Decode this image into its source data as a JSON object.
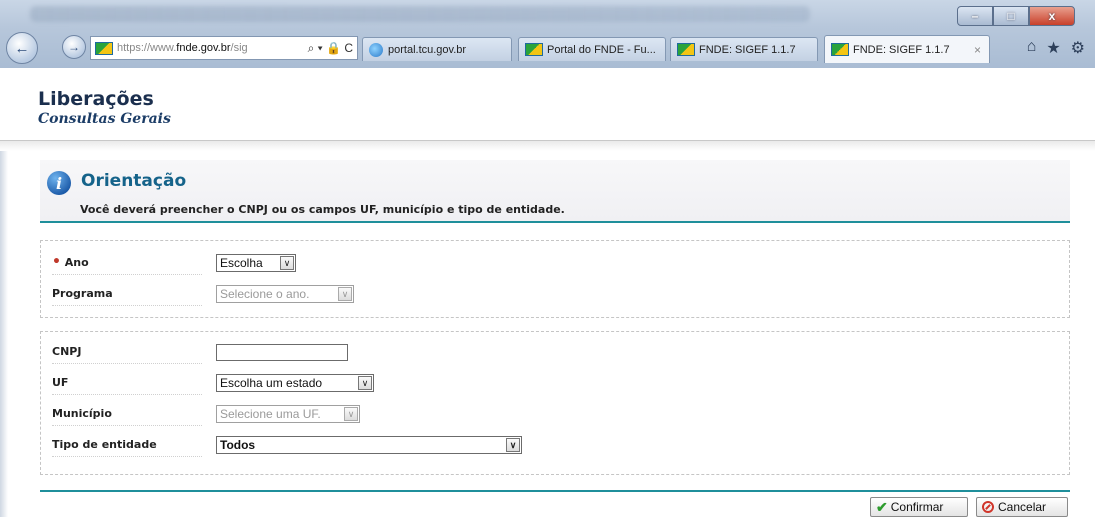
{
  "browser": {
    "address_prefix": "https://www.",
    "address_host": "fnde.gov.br",
    "address_suffix": "/sig",
    "address_tools": "⌕ ▾ 🔒 C",
    "tabs": [
      {
        "label": "portal.tcu.gov.br"
      },
      {
        "label": "Portal do FNDE - Fu..."
      },
      {
        "label": "FNDE: SIGEF 1.1.7"
      },
      {
        "label": "FNDE: SIGEF 1.1.7",
        "active": true
      }
    ],
    "tab_close": "×",
    "window_buttons": {
      "minimize": "–",
      "maximize": "□",
      "close": "x"
    },
    "toolbar_icons": {
      "home": "⌂",
      "favorites": "★",
      "settings": "⚙"
    },
    "nav": {
      "back": "←",
      "forward": "→"
    }
  },
  "header": {
    "title": "Liberações",
    "subtitle": "Consultas Gerais"
  },
  "orientation": {
    "icon": "i",
    "title": "Orientação",
    "text": "Você deverá preencher o CNPJ ou os campos UF, município e tipo de entidade."
  },
  "form": {
    "required_mark": "•",
    "ano": {
      "label": "Ano",
      "value": "Escolha"
    },
    "programa": {
      "label": "Programa",
      "value": "Selecione o ano."
    },
    "cnpj": {
      "label": "CNPJ",
      "value": ""
    },
    "uf": {
      "label": "UF",
      "value": "Escolha um estado"
    },
    "municipio": {
      "label": "Município",
      "value": "Selecione uma UF."
    },
    "tipo_entidade": {
      "label": "Tipo de entidade",
      "value": "Todos"
    },
    "dropdown_arrow": "∨"
  },
  "actions": {
    "confirm": "Confirmar",
    "cancel": "Cancelar"
  }
}
